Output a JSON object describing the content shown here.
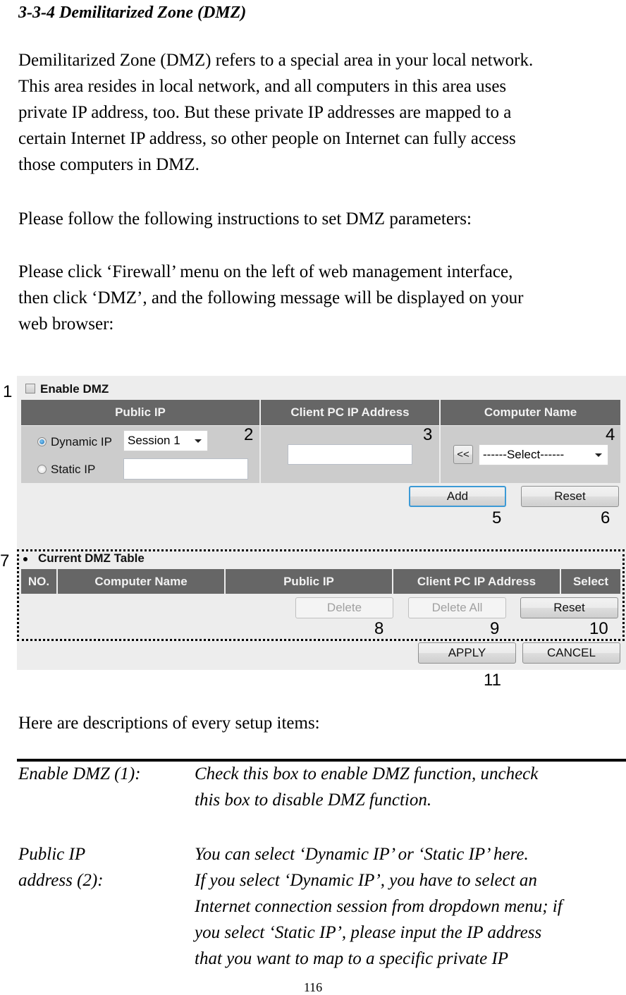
{
  "document": {
    "section_title": "3-3-4 Demilitarized Zone (DMZ)",
    "intro_lines": [
      "Demilitarized Zone (DMZ) refers to a special area in your local network.",
      "This area resides in local network, and all computers in this area uses",
      "private IP address, too. But these private IP addresses are mapped to a",
      "certain Internet IP address, so other people on Internet can fully access",
      "those computers in DMZ."
    ],
    "instruction": "Please follow the following instructions to set DMZ parameters:",
    "click_lines": [
      "Please click ‘Firewall’ menu on the left of web management interface,",
      "then click ‘DMZ’, and the following message will be displayed on your",
      "web browser:"
    ],
    "descriptions_heading": "Here are descriptions of every setup items:",
    "items": [
      {
        "term_lines": [
          "Enable DMZ (1):"
        ],
        "desc_lines": [
          "Check this box to enable DMZ function, uncheck",
          "this box to disable DMZ function."
        ]
      },
      {
        "term_lines": [
          "Public IP",
          "address (2):"
        ],
        "desc_lines": [
          "You can select ‘Dynamic IP’ or ‘Static IP’ here.",
          "If you select ‘Dynamic IP’, you have to select an",
          "Internet connection session from dropdown menu; if",
          "you select ‘Static IP’, please input the IP address",
          "that you want to map to a specific private IP"
        ]
      }
    ],
    "page_number": "116"
  },
  "ui": {
    "enable_dmz": {
      "label": "Enable DMZ",
      "checked": false
    },
    "headers": {
      "public_ip": "Public IP",
      "client_pc_ip": "Client PC IP Address",
      "computer_name": "Computer Name"
    },
    "public_ip": {
      "dynamic_label": "Dynamic IP",
      "dynamic_selected": true,
      "session_value": "Session 1",
      "static_label": "Static IP",
      "static_value": ""
    },
    "client_ip_value": "",
    "copy_button": "<<",
    "computer_select_value": "------Select------",
    "add_button": "Add",
    "reset_button": "Reset",
    "dmz_table": {
      "title": "Current DMZ Table",
      "columns": [
        "NO.",
        "Computer Name",
        "Public IP",
        "Client PC IP Address",
        "Select"
      ],
      "rows": []
    },
    "delete_button": "Delete",
    "delete_all_button": "Delete All",
    "table_reset_button": "Reset",
    "apply_button": "APPLY",
    "cancel_button": "CANCEL"
  },
  "callouts": [
    "1",
    "2",
    "3",
    "4",
    "5",
    "6",
    "7",
    "8",
    "9",
    "10",
    "11"
  ],
  "colors": {
    "header_bg": "#666666",
    "cell_bg": "#cccccc",
    "panel_bg": "#ededed",
    "focus_border": "#3c9ad6"
  }
}
